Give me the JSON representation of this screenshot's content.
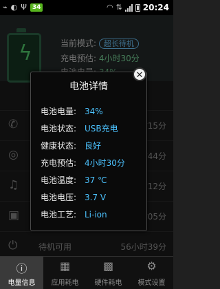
{
  "status_bar": {
    "sd_badge": "34",
    "time": "20:24"
  },
  "background": {
    "mode_label": "当前模式:",
    "mode_value": "超长待机",
    "charge_label": "充电预估:",
    "charge_value": "4小时30分",
    "level_label": "电池电量:",
    "level_value": "34%",
    "rows": [
      {
        "icon": "phone-icon",
        "label": "",
        "time": "时15分"
      },
      {
        "icon": "globe-icon",
        "label": "",
        "time": "时44分"
      },
      {
        "icon": "music-icon",
        "label": "",
        "time": "时12分"
      },
      {
        "icon": "video-icon",
        "label": "",
        "time": "时05分"
      },
      {
        "icon": "standby-icon",
        "label": "待机可用",
        "time": "56小时39分"
      }
    ]
  },
  "dialog": {
    "title": "电池详情",
    "rows": [
      {
        "label": "电池电量:",
        "value": "34%"
      },
      {
        "label": "电池状态:",
        "value": "USB充电"
      },
      {
        "label": "健康状态:",
        "value": "良好"
      },
      {
        "label": "充电预估:",
        "value": "4小时30分"
      },
      {
        "label": "电池温度:",
        "value": "37 ℃"
      },
      {
        "label": "电池电压:",
        "value": "3.7 V"
      },
      {
        "label": "电池工艺:",
        "value": "Li-ion"
      }
    ]
  },
  "tabs": [
    {
      "label": "电量信息",
      "icon": "info-icon",
      "active": true
    },
    {
      "label": "应用耗电",
      "icon": "apps-icon",
      "active": false
    },
    {
      "label": "硬件耗电",
      "icon": "chip-icon",
      "active": false
    },
    {
      "label": "模式设置",
      "icon": "gear-icon",
      "active": false
    }
  ],
  "colors": {
    "accent_blue": "#4cc3ff",
    "status_green": "#58b51f"
  }
}
